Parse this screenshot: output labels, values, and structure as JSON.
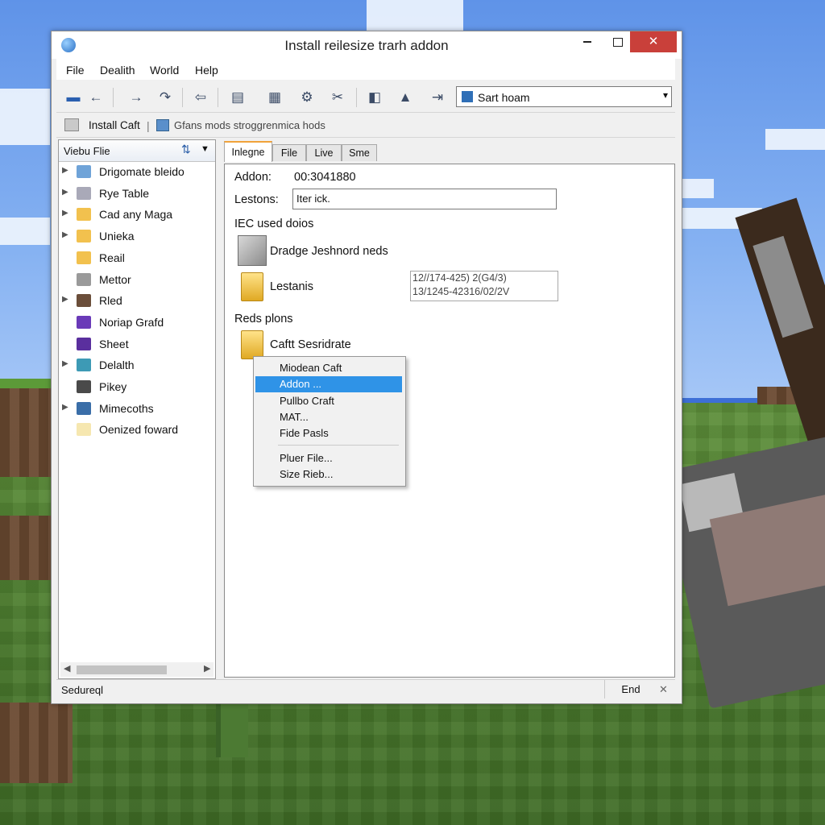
{
  "window": {
    "title": "Install reilesize trarh addon",
    "close_glyph": "✕"
  },
  "menu": [
    "File",
    "Dealith",
    "World",
    "Help"
  ],
  "toolbar": {
    "combo_value": "Sart hoam",
    "combo_arrow": "▾"
  },
  "addressbar": {
    "install_label": "Install Caft",
    "path_text": "Gfans mods stroggrenmica hods"
  },
  "tree": {
    "header": "Viebu Flie",
    "items": [
      {
        "label": "Drigomate bleido",
        "expandable": true,
        "color": "#6fa3d8"
      },
      {
        "label": "Rye Table",
        "expandable": true,
        "color": "#a9a9b8"
      },
      {
        "label": "Cad any Maga",
        "expandable": true,
        "color": "#f2c14e"
      },
      {
        "label": "Unieka",
        "expandable": true,
        "color": "#f2c14e"
      },
      {
        "label": "Reail",
        "expandable": false,
        "color": "#f2c14e"
      },
      {
        "label": "Mettor",
        "expandable": false,
        "color": "#9a9a9a"
      },
      {
        "label": "Rled",
        "expandable": true,
        "color": "#6b4e3a"
      },
      {
        "label": "Noriap Grafd",
        "expandable": false,
        "color": "#6a3ab8"
      },
      {
        "label": "Sheet",
        "expandable": false,
        "color": "#5a2f9e"
      },
      {
        "label": "Delalth",
        "expandable": true,
        "color": "#3d9ab5"
      },
      {
        "label": "Pikey",
        "expandable": false,
        "color": "#4a4a4a"
      },
      {
        "label": "Mimecoths",
        "expandable": true,
        "color": "#3a6ea8"
      },
      {
        "label": "Oenized foward",
        "expandable": false,
        "color": "#f6e7b0"
      }
    ]
  },
  "tabs": [
    "Inlegne",
    "File",
    "Live",
    "Sme"
  ],
  "content": {
    "addon_label": "Addon:",
    "addon_value": "00:3041880",
    "lestons_label": "Lestons:",
    "lestons_value": "Iter ick.",
    "used_section": "IEC used doios",
    "item1": "Dradge Jeshnord neds",
    "item2": "Lestanis",
    "info_line1": "12//174-425) 2(G4/3)",
    "info_line2": "13/1245-42316/02/2V",
    "reds_section": "Reds plons",
    "item3": "Caftt Sesridrate"
  },
  "context_menu": {
    "items": [
      "Miodean Caft",
      "Addon ...",
      "Pullbo Craft",
      "MAT...",
      "Fide Pasls",
      "Pluer File...",
      "Size Rieb..."
    ],
    "selected_index": 1
  },
  "status": {
    "left": "Sedureql",
    "end": "End",
    "close": "✕"
  },
  "colors": {
    "accent": "#2f93e7",
    "close_button": "#c9403a",
    "tab_highlight": "#f1a33a"
  }
}
